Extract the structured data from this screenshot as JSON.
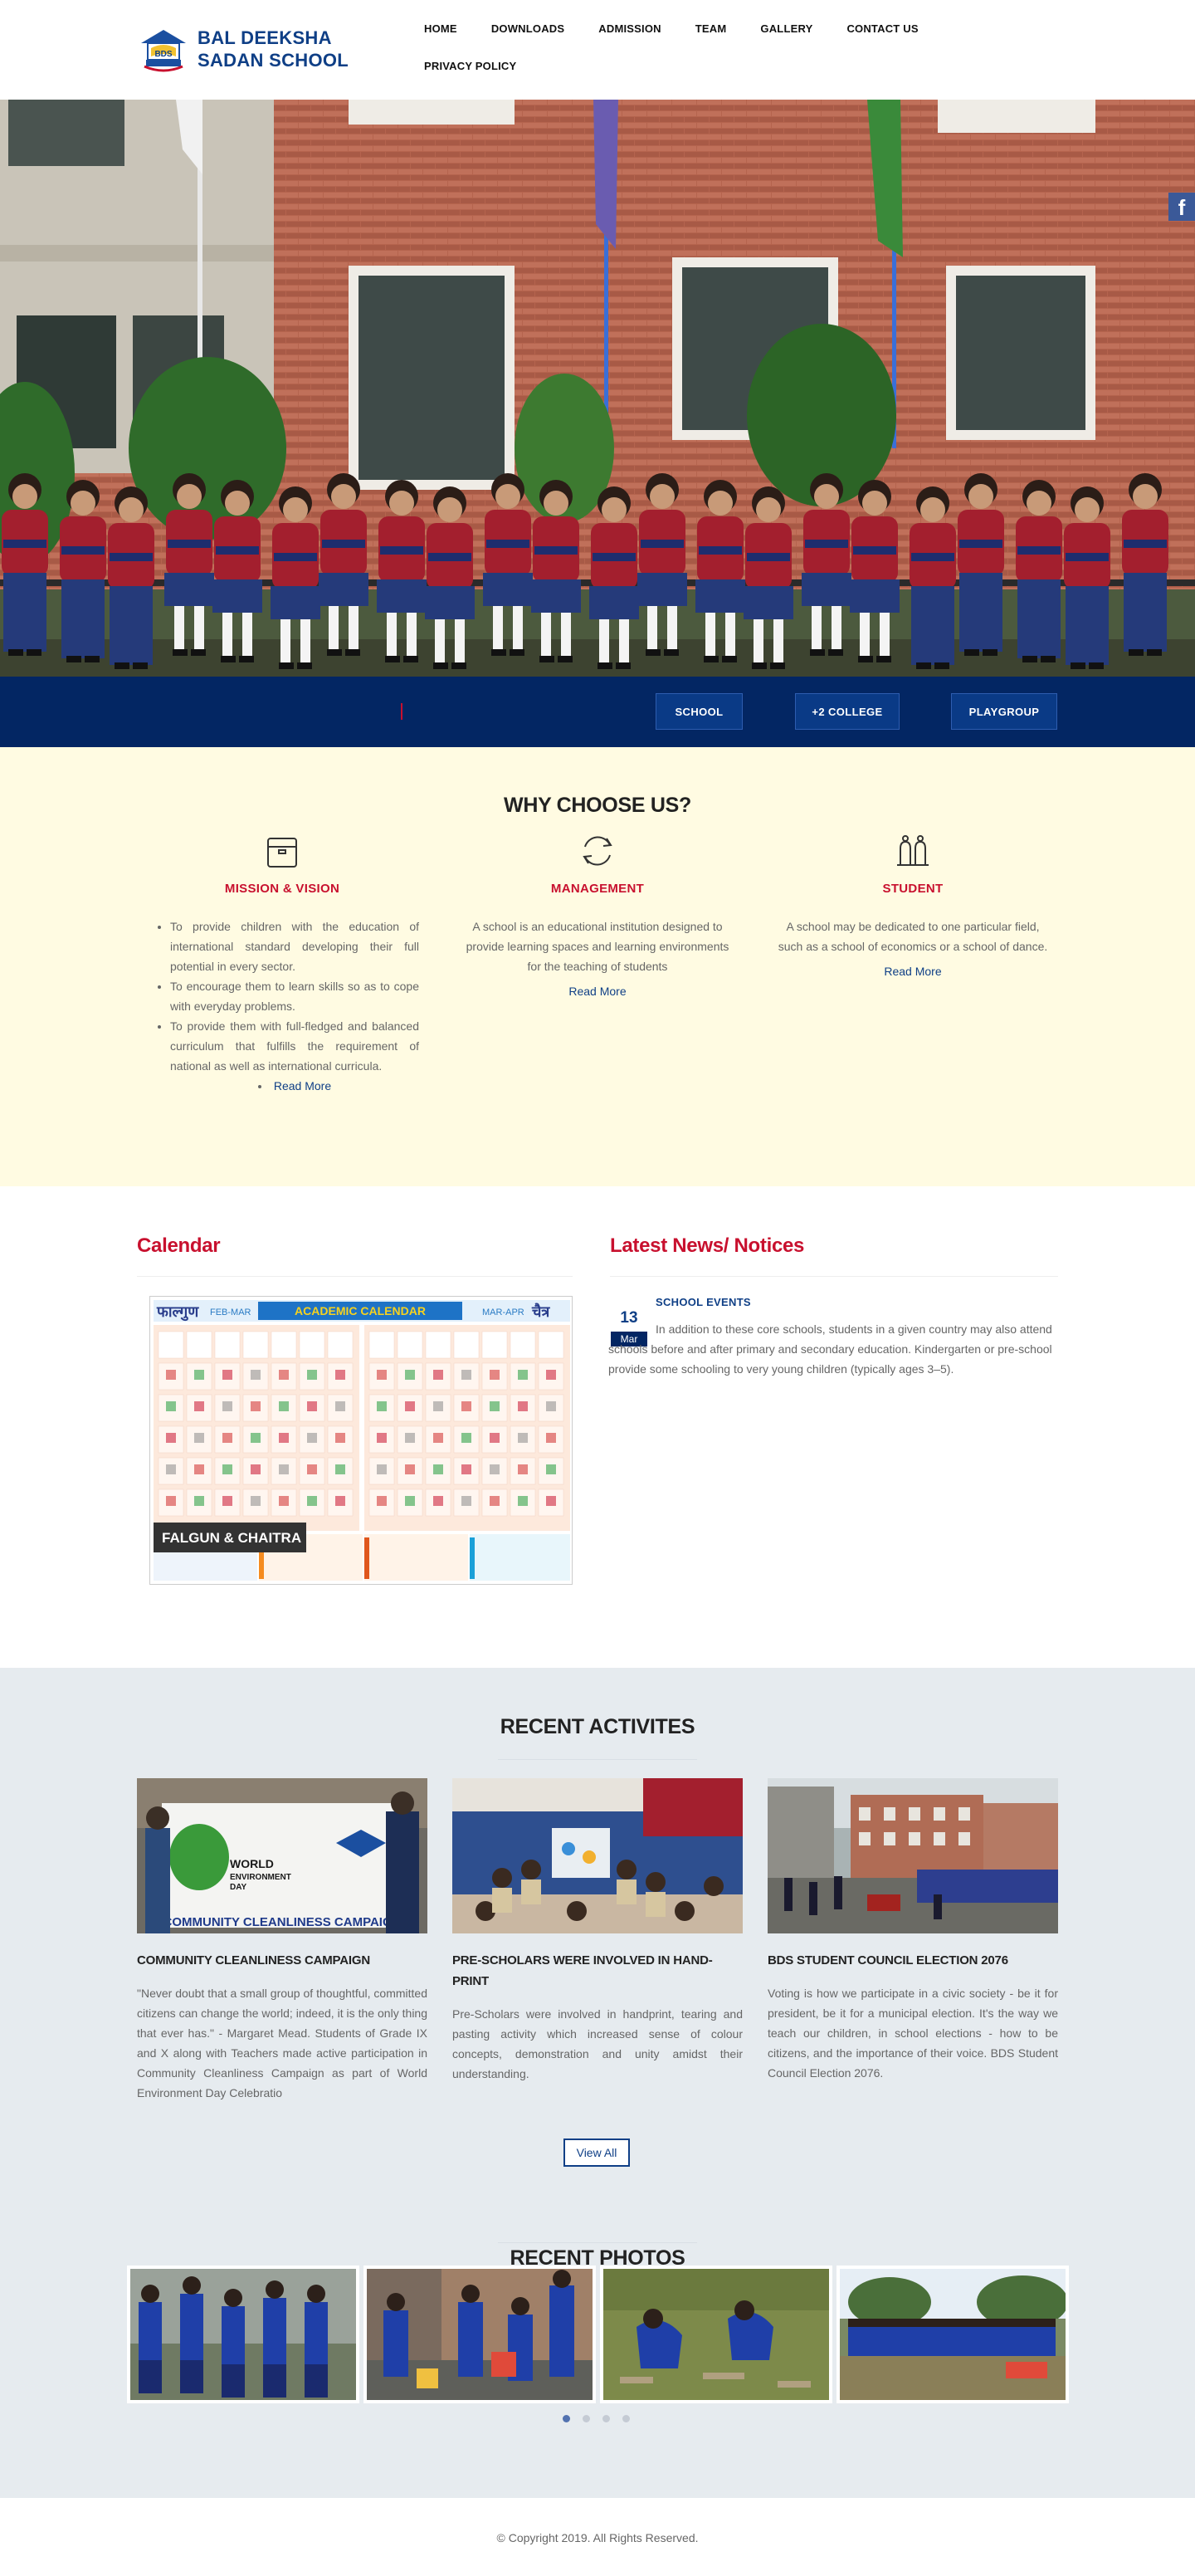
{
  "brand": {
    "name_line1": "BAL DEEKSHA",
    "name_line2": "SADAN SCHOOL",
    "badge_text": "BDS"
  },
  "nav": [
    "HOME",
    "DOWNLOADS",
    "ADMISSION",
    "TEAM",
    "GALLERY",
    "CONTACT US",
    "PRIVACY POLICY"
  ],
  "hero": {
    "facebook_glyph": "f"
  },
  "bluebar": {
    "buttons": [
      "SCHOOL",
      "+2 COLLEGE",
      "PLAYGROUP"
    ]
  },
  "why": {
    "title": "WHY CHOOSE US?",
    "columns": [
      {
        "icon": "box-icon",
        "title": "MISSION & VISION",
        "bullets": [
          "To provide children with the education of international standard developing their full potential in every sector.",
          "To encourage them to learn skills so as to cope with everyday problems.",
          "To provide them with full-fledged and balanced curriculum that fulfills the requirement of national as well as international curricula."
        ],
        "more": "Read More"
      },
      {
        "icon": "refresh-icon",
        "title": "MANAGEMENT",
        "text": "A school is an educational institution designed to provide learning spaces and learning environments for the teaching of students",
        "more": "Read More"
      },
      {
        "icon": "hands-icon",
        "title": "STUDENT",
        "text": "A school may be dedicated to one particular field, such as a school of economics or a school of dance.",
        "more": "Read More"
      }
    ]
  },
  "calendar": {
    "heading": "Calendar",
    "image": {
      "month_left": "फाल्गुण",
      "range_left": "FEB-MAR",
      "banner": "ACADEMIC CALENDAR",
      "range_right": "MAR-APR",
      "month_right": "चैत्र",
      "caption": "FALGUN & CHAITRA"
    }
  },
  "news": {
    "heading": "Latest News/ Notices",
    "date_day": "13",
    "date_month": "Mar",
    "title": "SCHOOL EVENTS",
    "text": "In addition to these core schools, students in a given country may also attend schools before and after primary and secondary education. Kindergarten or pre-school provide some schooling to very young children (typically ages 3–5)."
  },
  "activities": {
    "title": "RECENT ACTIVITES",
    "items": [
      {
        "title": "COMMUNITY CLEANLINESS CAMPAIGN",
        "text": "\"Never doubt that a small group of thoughtful, committed citizens can change the world; indeed, it is the only thing that ever has.\" - Margaret Mead. Students of Grade IX and X along with Teachers made active participation in Community Cleanliness Campaign as part of World Environment Day Celebratio",
        "banner_line1": "WORLD",
        "banner_line2": "ENVIRONMENT",
        "banner_line3": "DAY",
        "banner_caption": "COMMUNITY CLEANLINESS CAMPAIGN"
      },
      {
        "title": "PRE-SCHOLARS WERE INVOLVED IN HAND-PRINT",
        "text": "Pre-Scholars were involved in handprint, tearing and pasting activity which increased sense of colour concepts, demonstration and unity amidst their understanding."
      },
      {
        "title": "BDS STUDENT COUNCIL ELECTION 2076",
        "text": "Voting is how we participate in a civic society - be it for president, be it for a municipal election. It's the way we teach our children, in school elections - how to be citizens, and the importance of their voice. BDS Student Council Election 2076."
      }
    ],
    "view_all": "View All"
  },
  "photos": {
    "title": "RECENT PHOTOS"
  },
  "footer": {
    "copyright": "© Copyright 2019. All Rights Reserved."
  }
}
